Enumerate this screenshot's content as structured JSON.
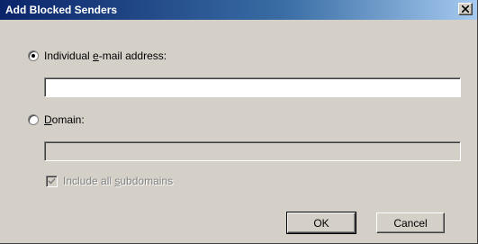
{
  "window": {
    "title": "Add Blocked Senders",
    "close_icon": "close-icon",
    "title_color": "#0a246a"
  },
  "individual": {
    "label_pre": "Individual ",
    "label_accel": "e",
    "label_post": "-mail address:",
    "selected": true,
    "value": ""
  },
  "domain": {
    "label_accel": "D",
    "label_post": "omain:",
    "selected": false,
    "value": ""
  },
  "subdomains": {
    "label_pre": "Include all ",
    "label_accel": "s",
    "label_post": "ubdomains",
    "checked": true,
    "disabled": true
  },
  "buttons": {
    "ok": "OK",
    "cancel": "Cancel"
  }
}
